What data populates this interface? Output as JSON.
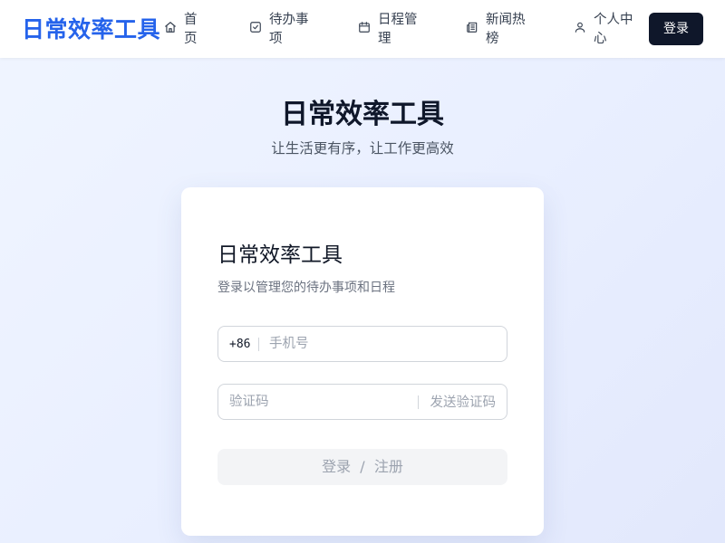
{
  "header": {
    "logo": "日常效率工具",
    "nav": {
      "home": [
        "首",
        "页"
      ],
      "todo": [
        "待办事",
        "项"
      ],
      "schedule": [
        "日程管",
        "理"
      ],
      "news": [
        "新闻热",
        "榜"
      ],
      "profile": [
        "个人中",
        "心"
      ]
    },
    "login_label": "登录"
  },
  "hero": {
    "title": "日常效率工具",
    "subtitle": "让生活更有序，让工作更高效"
  },
  "login_card": {
    "title": "日常效率工具",
    "subtitle": "登录以管理您的待办事项和日程",
    "phone_prefix": "+86",
    "phone_placeholder": "手机号",
    "code_placeholder": "验证码",
    "send_code_label": "发送验证码",
    "submit_label": "登录  /  注册"
  }
}
